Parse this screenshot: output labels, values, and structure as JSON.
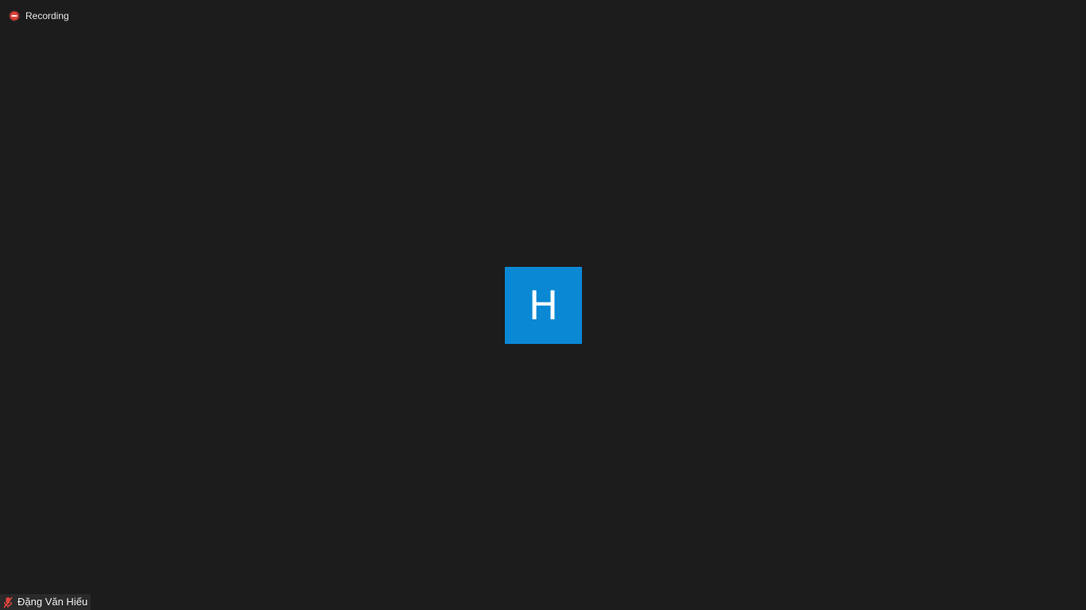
{
  "recording": {
    "label": "Recording",
    "icon": "record-icon",
    "color": "#e0443a"
  },
  "participant": {
    "initial": "H",
    "avatar_color": "#0a88d4",
    "name": "Đặng Văn Hiếu",
    "mic_icon": "microphone-muted-icon",
    "mic_color": "#e0443a"
  },
  "theme": {
    "background": "#1c1c1c"
  }
}
